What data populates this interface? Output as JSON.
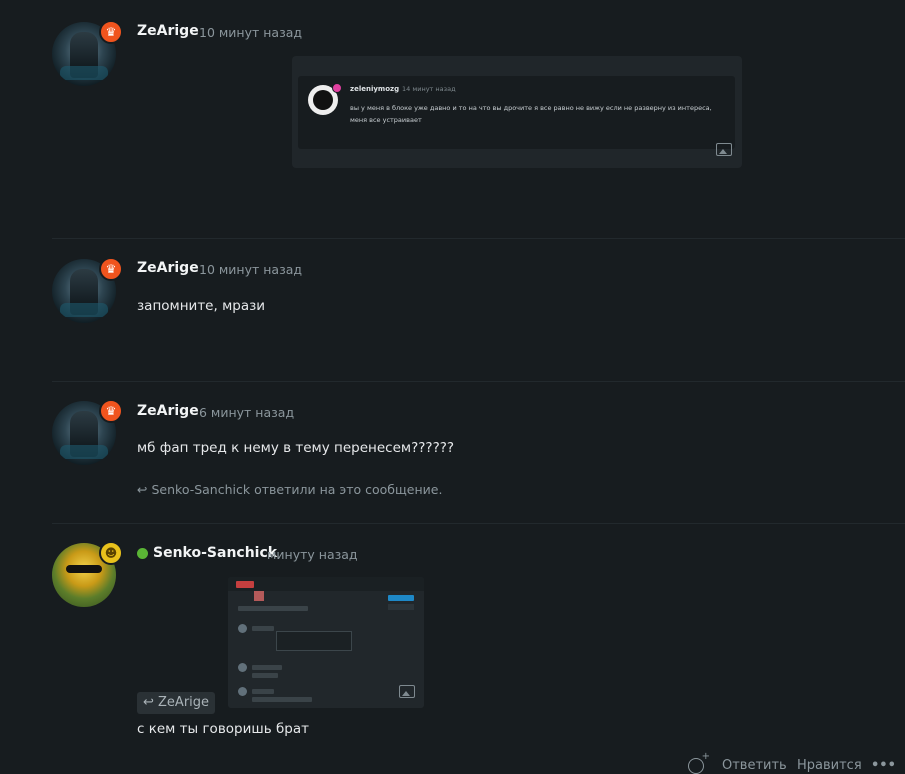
{
  "messages": [
    {
      "author": "ZeArige",
      "time": "10 минут назад",
      "avatar_badge_icon": "trophy-icon",
      "embed": {
        "author": "zeleniymozg",
        "time": "14 минут назад",
        "text": "вы у меня в блоке уже давно и то на что вы дрочите я все равно не вижу если не разверну из интереса, меня все устраивает"
      }
    },
    {
      "author": "ZeArige",
      "time": "10 минут назад",
      "avatar_badge_icon": "trophy-icon",
      "text": "запомните, мрази"
    },
    {
      "author": "ZeArige",
      "time": "6 минут назад",
      "avatar_badge_icon": "trophy-icon",
      "text": "мб фап тред к нему в тему перенесем??????",
      "replied_by": "Senko-Sanchick ответили на это сообщение."
    },
    {
      "author": "Senko-Sanchick",
      "time": "минуту назад",
      "avatar_badge_icon": "skull-icon",
      "online": true,
      "reply_to": "ZeArige",
      "text": "с кем ты говоришь брат"
    }
  ],
  "actions": {
    "reply": "Ответить",
    "like": "Нравится",
    "more": "•••"
  },
  "colors": {
    "background": "#171c1f",
    "badge_orange": "#f0541e",
    "badge_yellow": "#e9c21c",
    "online": "#5ab535"
  }
}
